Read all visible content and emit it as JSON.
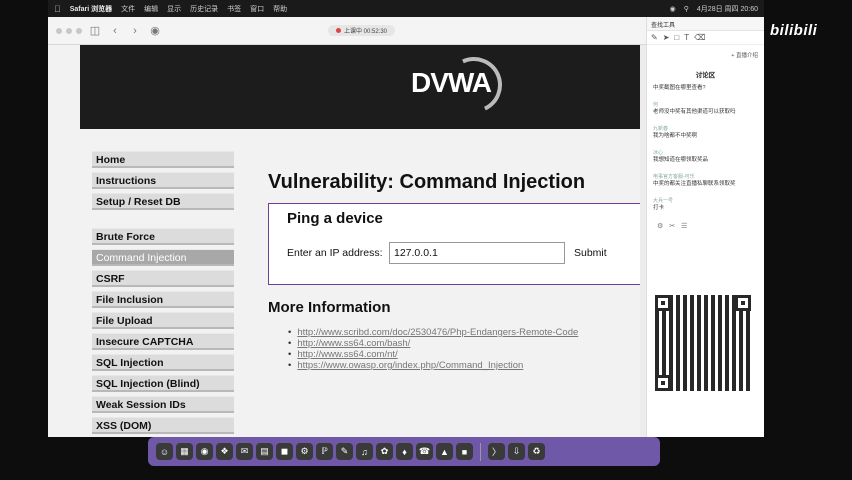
{
  "menubar": {
    "app": "Safari 浏览器",
    "items": [
      "文件",
      "编辑",
      "显示",
      "历史记录",
      "书签",
      "窗口",
      "帮助"
    ],
    "clock": "4月28日 周四 20:60"
  },
  "browser": {
    "url_status": "上课中 00:52:30"
  },
  "dvwa": {
    "logo": "DVWA",
    "menu_group1": [
      "Home",
      "Instructions",
      "Setup / Reset DB"
    ],
    "menu_group2": [
      "Brute Force",
      "Command Injection",
      "CSRF",
      "File Inclusion",
      "File Upload",
      "Insecure CAPTCHA",
      "SQL Injection",
      "SQL Injection (Blind)",
      "Weak Session IDs",
      "XSS (DOM)"
    ],
    "selected": "Command Injection",
    "page_title": "Vulnerability: Command Injection",
    "ping_title": "Ping a device",
    "ip_label": "Enter an IP address:",
    "ip_value": "127.0.0.1",
    "submit_label": "Submit",
    "more_info_title": "More Information",
    "links": [
      "http://www.scribd.com/doc/2530476/Php-Endangers-Remote-Code",
      "http://www.ss64.com/bash/",
      "http://www.ss64.com/nt/",
      "https://www.owasp.org/index.php/Command_Injection"
    ]
  },
  "side_panel": {
    "header": "查找工具",
    "live_link": "+ 直播介绍",
    "discuss_title": "讨论区",
    "comments": [
      {
        "user": "",
        "text": "中奖截图在哪里查看?"
      },
      {
        "user": "何",
        "text": "老师没中奖有其他渠道可以获取吗"
      },
      {
        "user": "九新春",
        "text": "我为啥都不中奖啊"
      },
      {
        "user": "冰心",
        "text": "我想知道在哪领取奖品"
      },
      {
        "user": "电事官方客服-可乐",
        "text": "中奖的都关注直播私聊联系领取奖"
      },
      {
        "user": "大兵一号",
        "text": "打卡"
      }
    ]
  },
  "watermark": "bilibili",
  "colors": {
    "dvwa_header": "#1c1c1c",
    "menu_item": "#dcdcdc",
    "menu_selected": "#a8a8a8",
    "ping_border": "#6b3fa0",
    "dock": "#6f58a8"
  }
}
